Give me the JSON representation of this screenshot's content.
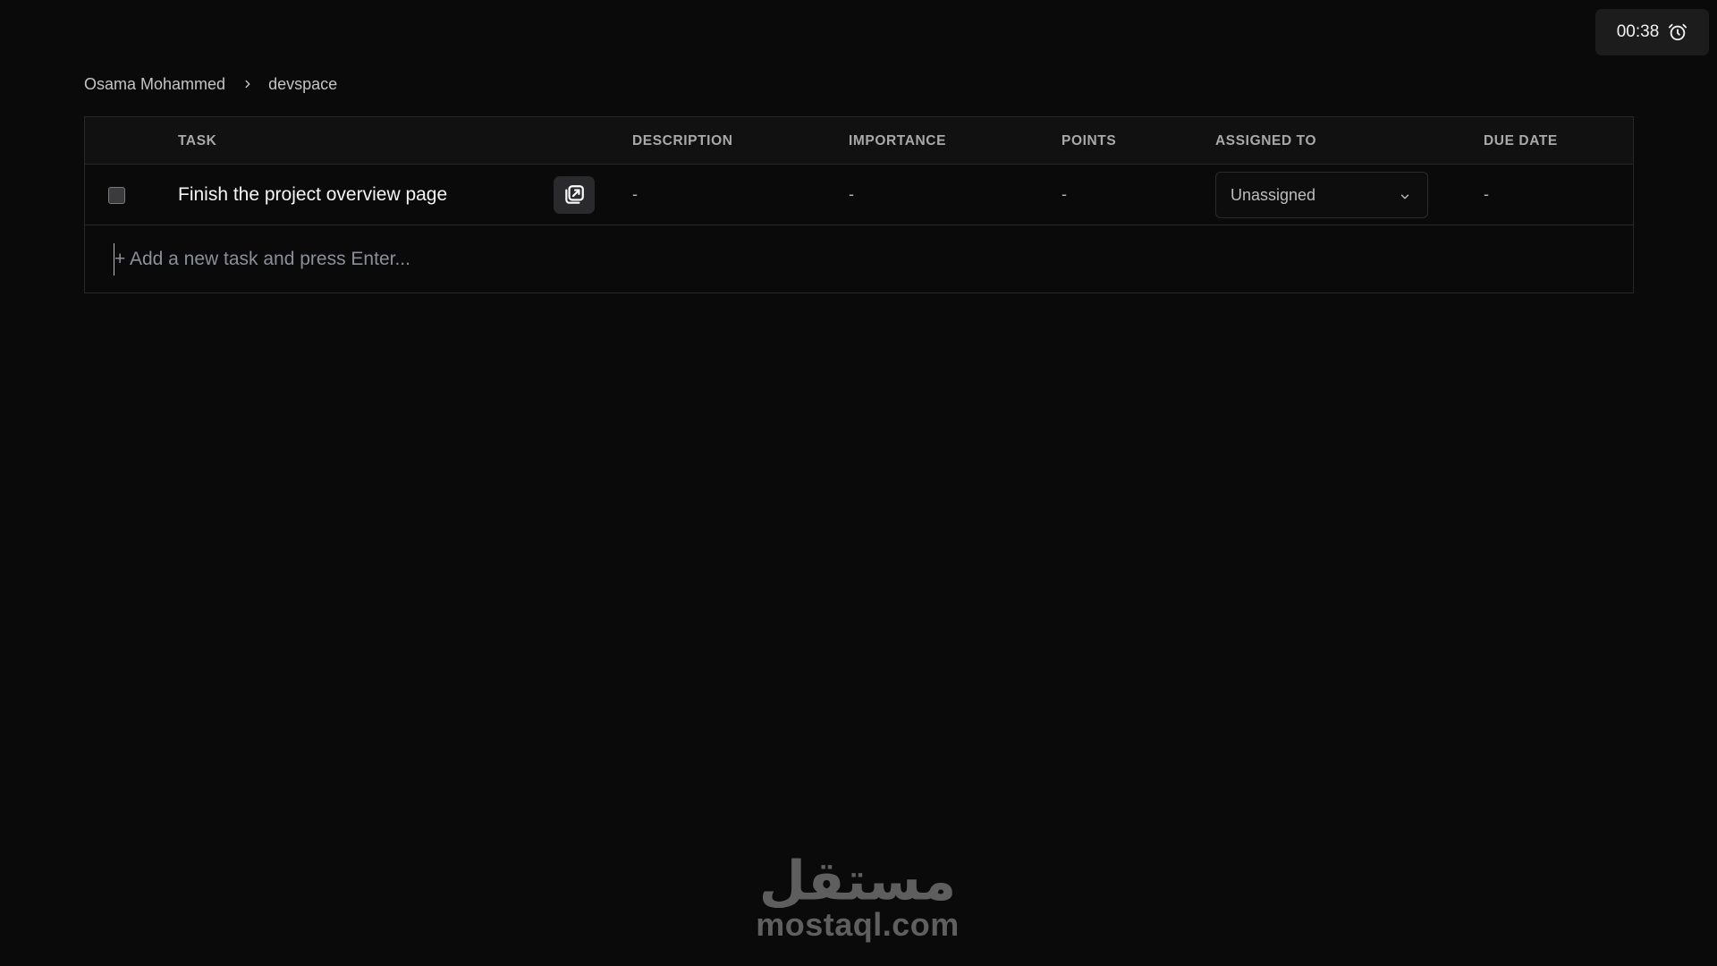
{
  "timer": {
    "time": "00:38",
    "icon": "alarm-clock-icon"
  },
  "breadcrumb": {
    "items": [
      {
        "label": "Osama Mohammed"
      },
      {
        "label": "devspace"
      }
    ],
    "separator_icon": "chevron-right-icon"
  },
  "table": {
    "columns": {
      "task": "TASK",
      "description": "DESCRIPTION",
      "importance": "IMPORTANCE",
      "points": "POINTS",
      "assigned_to": "ASSIGNED TO",
      "due_date": "DUE DATE"
    },
    "rows": [
      {
        "checked": false,
        "task": "Finish the project overview page",
        "open_icon": "open-in-new-icon",
        "description": "-",
        "importance": "-",
        "points": "-",
        "assigned_to": "Unassigned",
        "due_date": "-"
      }
    ],
    "add_task": {
      "placeholder": "+ Add a new task and press Enter...",
      "value": ""
    }
  },
  "watermark": {
    "text": "mostaql.com",
    "logo_text": "مستقل"
  },
  "colors": {
    "background": "#0b0a0a",
    "header_background": "#111112",
    "border": "#26272a",
    "timer_background": "#1c1c1d"
  }
}
